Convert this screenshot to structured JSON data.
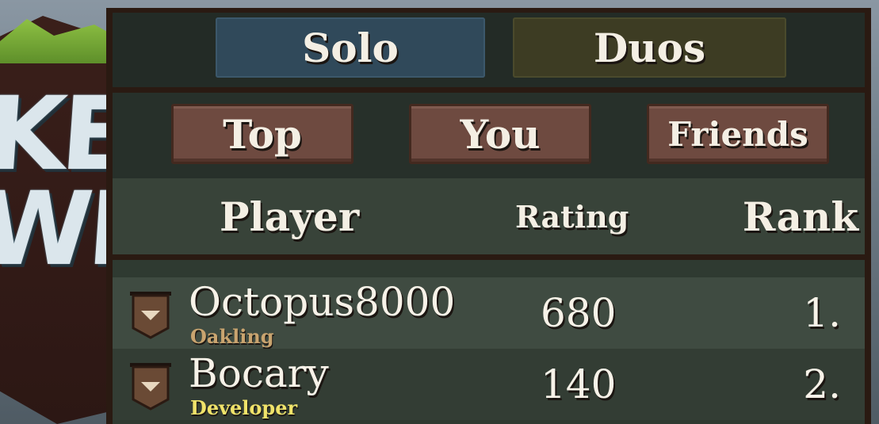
{
  "modes": [
    {
      "label": "Solo",
      "selected": true
    },
    {
      "label": "Duos",
      "selected": false
    }
  ],
  "filters": [
    {
      "label": "Top"
    },
    {
      "label": "You"
    },
    {
      "label": "Friends"
    }
  ],
  "columns": {
    "player": "Player",
    "rating": "Rating",
    "rank": "Rank"
  },
  "players": [
    {
      "name": "Octopus8000",
      "title": "Oakling",
      "title_color": "#c9a46f",
      "rating": "680",
      "rank": "1."
    },
    {
      "name": "Bocary",
      "title": "Developer",
      "title_color": "#f0e36a",
      "rating": "140",
      "rank": "2."
    }
  ],
  "icons": {
    "row_badge": "banner-badge-icon"
  },
  "colors": {
    "panel": "#2b3229",
    "solo_button": "#30495a",
    "duos_button": "#3d3c23",
    "filter_button": "#6e4a40",
    "border": "#2a1a12"
  }
}
